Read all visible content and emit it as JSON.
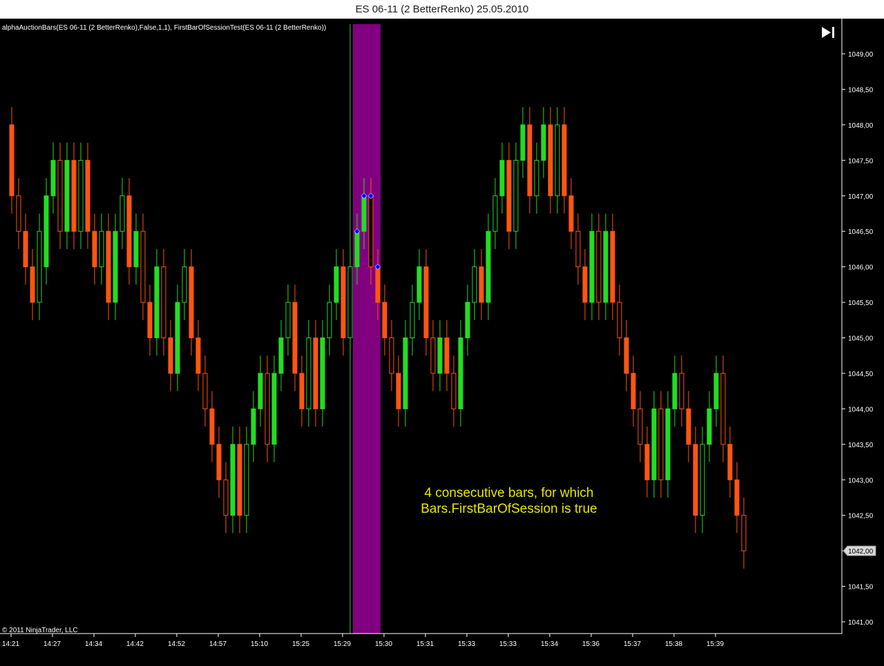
{
  "window": {
    "title": "ES 06-11 (2 BetterRenko)  25.05.2010"
  },
  "indicator_label": "alphaAuctionBars(ES 06-11 (2 BetterRenko),False,1,1), FirstBarOfSessionTest(ES 06-11 (2 BetterRenko))",
  "copyright": "© 2011 NinjaTrader, LLC",
  "annotation": {
    "line1": "4 consecutive bars, for which",
    "line2": "Bars.FirstBarOfSession is true"
  },
  "last_price_label": "1042,00",
  "colors": {
    "background": "#000000",
    "up": "#22dd22",
    "down": "#ff5511",
    "session_highlight": "#800080",
    "marker": "#0000ff",
    "annotation": "#e6e600",
    "axis": "#ffffff"
  },
  "chart_data": {
    "type": "candlestick",
    "y_ticks": [
      "1049,00",
      "1048,50",
      "1048,00",
      "1047,50",
      "1047,00",
      "1046,50",
      "1046,00",
      "1045,50",
      "1045,00",
      "1044,50",
      "1044,00",
      "1043,50",
      "1043,00",
      "1042,50",
      "1042,00",
      "1041,50",
      "1041,00"
    ],
    "x_ticks": [
      "14:21",
      "14:27",
      "14:34",
      "14:42",
      "14:52",
      "14:57",
      "15:10",
      "15:25",
      "15:29",
      "15:30",
      "15:31",
      "15:33",
      "15:33",
      "15:34",
      "15:36",
      "15:37",
      "15:38",
      "15:39"
    ],
    "ylim": [
      1040.8,
      1049.3
    ],
    "highlight_bars": [
      50,
      53
    ],
    "marker_bars": [
      50,
      51,
      52,
      53
    ],
    "bars": [
      [
        1048.0,
        1047.0
      ],
      [
        1047.0,
        1046.5
      ],
      [
        1046.5,
        1046.0
      ],
      [
        1046.0,
        1045.5
      ],
      [
        1045.5,
        1046.5
      ],
      [
        1046.0,
        1047.0
      ],
      [
        1047.0,
        1047.5
      ],
      [
        1047.5,
        1046.5
      ],
      [
        1046.5,
        1047.5
      ],
      [
        1047.5,
        1046.5
      ],
      [
        1046.5,
        1047.5
      ],
      [
        1047.5,
        1046.5
      ],
      [
        1046.5,
        1046.0
      ],
      [
        1046.0,
        1046.5
      ],
      [
        1046.5,
        1045.5
      ],
      [
        1045.5,
        1046.5
      ],
      [
        1046.5,
        1047.0
      ],
      [
        1047.0,
        1046.0
      ],
      [
        1046.0,
        1046.5
      ],
      [
        1046.5,
        1045.5
      ],
      [
        1045.5,
        1045.0
      ],
      [
        1045.0,
        1046.0
      ],
      [
        1046.0,
        1045.0
      ],
      [
        1045.0,
        1044.5
      ],
      [
        1044.5,
        1045.5
      ],
      [
        1045.5,
        1046.0
      ],
      [
        1046.0,
        1045.0
      ],
      [
        1045.0,
        1044.5
      ],
      [
        1044.5,
        1044.0
      ],
      [
        1044.0,
        1043.5
      ],
      [
        1043.5,
        1043.0
      ],
      [
        1043.0,
        1042.5
      ],
      [
        1042.5,
        1043.5
      ],
      [
        1043.5,
        1042.5
      ],
      [
        1042.5,
        1043.5
      ],
      [
        1043.5,
        1044.0
      ],
      [
        1044.0,
        1044.5
      ],
      [
        1044.5,
        1043.5
      ],
      [
        1043.5,
        1044.5
      ],
      [
        1044.5,
        1045.0
      ],
      [
        1045.0,
        1045.5
      ],
      [
        1045.5,
        1044.5
      ],
      [
        1044.5,
        1044.0
      ],
      [
        1044.0,
        1045.0
      ],
      [
        1045.0,
        1044.0
      ],
      [
        1044.0,
        1045.0
      ],
      [
        1045.0,
        1045.5
      ],
      [
        1045.5,
        1046.0
      ],
      [
        1046.0,
        1045.0
      ],
      [
        1045.0,
        1046.0
      ],
      [
        1046.0,
        1046.5
      ],
      [
        1046.5,
        1047.0
      ],
      [
        1047.0,
        1046.0
      ],
      [
        1046.0,
        1045.5
      ],
      [
        1045.5,
        1045.0
      ],
      [
        1045.0,
        1044.5
      ],
      [
        1044.5,
        1044.0
      ],
      [
        1044.0,
        1045.0
      ],
      [
        1045.0,
        1045.5
      ],
      [
        1045.5,
        1046.0
      ],
      [
        1046.0,
        1045.0
      ],
      [
        1045.0,
        1044.5
      ],
      [
        1044.5,
        1045.0
      ],
      [
        1045.0,
        1044.5
      ],
      [
        1044.5,
        1044.0
      ],
      [
        1044.0,
        1045.0
      ],
      [
        1045.0,
        1045.5
      ],
      [
        1045.5,
        1046.0
      ],
      [
        1046.0,
        1045.5
      ],
      [
        1045.5,
        1046.5
      ],
      [
        1046.5,
        1047.0
      ],
      [
        1047.0,
        1047.5
      ],
      [
        1047.5,
        1046.5
      ],
      [
        1046.5,
        1047.5
      ],
      [
        1047.5,
        1048.0
      ],
      [
        1048.0,
        1047.0
      ],
      [
        1047.0,
        1047.5
      ],
      [
        1047.5,
        1048.0
      ],
      [
        1048.0,
        1047.0
      ],
      [
        1047.0,
        1048.0
      ],
      [
        1048.0,
        1047.0
      ],
      [
        1047.0,
        1046.5
      ],
      [
        1046.5,
        1046.0
      ],
      [
        1046.0,
        1045.5
      ],
      [
        1045.5,
        1046.5
      ],
      [
        1046.5,
        1045.5
      ],
      [
        1045.5,
        1046.5
      ],
      [
        1046.5,
        1045.5
      ],
      [
        1045.5,
        1045.0
      ],
      [
        1045.0,
        1044.5
      ],
      [
        1044.5,
        1044.0
      ],
      [
        1044.0,
        1043.5
      ],
      [
        1043.5,
        1043.0
      ],
      [
        1043.0,
        1044.0
      ],
      [
        1044.0,
        1043.0
      ],
      [
        1043.0,
        1044.0
      ],
      [
        1044.0,
        1044.5
      ],
      [
        1044.5,
        1044.0
      ],
      [
        1044.0,
        1043.5
      ],
      [
        1043.5,
        1042.5
      ],
      [
        1042.5,
        1043.5
      ],
      [
        1043.5,
        1044.0
      ],
      [
        1044.0,
        1044.5
      ],
      [
        1044.5,
        1043.5
      ],
      [
        1043.5,
        1043.0
      ],
      [
        1043.0,
        1042.5
      ],
      [
        1042.5,
        1042.0
      ]
    ]
  }
}
